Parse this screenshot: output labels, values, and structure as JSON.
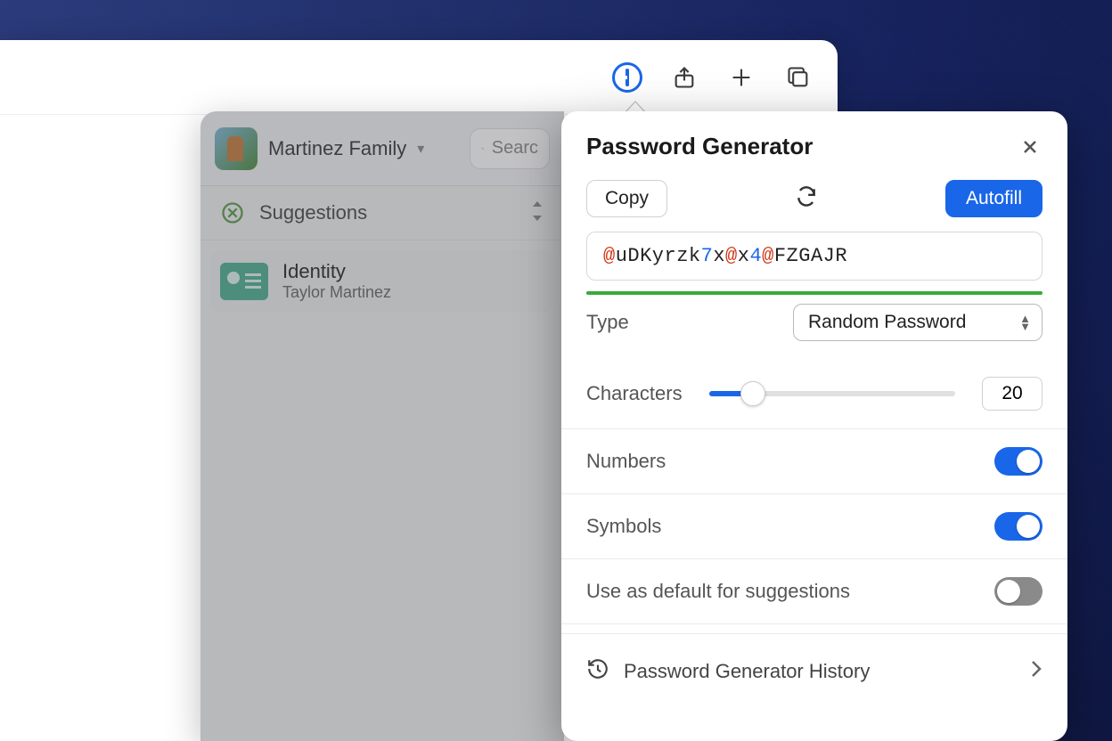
{
  "toolbar": {
    "extension_name": "1Password"
  },
  "background_popup": {
    "account_name": "Martinez Family",
    "search_placeholder": "Searc",
    "section_label": "Suggestions",
    "item": {
      "title": "Identity",
      "subtitle": "Taylor Martinez"
    }
  },
  "panel": {
    "title": "Password Generator",
    "copy_label": "Copy",
    "autofill_label": "Autofill",
    "password_segments": [
      {
        "t": "s",
        "v": "@"
      },
      {
        "t": "l",
        "v": "uDKyrzk"
      },
      {
        "t": "n",
        "v": "7"
      },
      {
        "t": "l",
        "v": "x"
      },
      {
        "t": "s",
        "v": "@"
      },
      {
        "t": "l",
        "v": "x"
      },
      {
        "t": "n",
        "v": "4"
      },
      {
        "t": "s",
        "v": "@"
      },
      {
        "t": "l",
        "v": "FZGAJR"
      }
    ],
    "type_label": "Type",
    "type_value": "Random Password",
    "characters_label": "Characters",
    "characters_value": "20",
    "numbers_label": "Numbers",
    "numbers_on": true,
    "symbols_label": "Symbols",
    "symbols_on": true,
    "default_label": "Use as default for suggestions",
    "default_on": false,
    "history_label": "Password Generator History"
  }
}
